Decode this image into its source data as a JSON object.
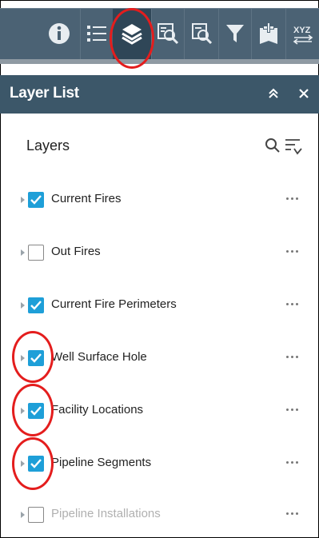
{
  "toolbar": {
    "tools": [
      {
        "icon": "info-icon"
      },
      {
        "icon": "legend-icon"
      },
      {
        "icon": "layers-icon",
        "active": true
      },
      {
        "icon": "query-icon"
      },
      {
        "icon": "query-result-icon"
      },
      {
        "icon": "filter-icon"
      },
      {
        "icon": "add-data-icon"
      },
      {
        "icon": "xyz-coordinate-icon",
        "text": "XYZ"
      }
    ]
  },
  "panel": {
    "title": "Layer List",
    "collapse_label": "≈",
    "close_label": "×"
  },
  "layers": {
    "heading": "Layers",
    "items": [
      {
        "label": "Current Fires",
        "checked": true
      },
      {
        "label": "Out Fires",
        "checked": false
      },
      {
        "label": "Current Fire Perimeters",
        "checked": true
      },
      {
        "label": "Well Surface Hole",
        "checked": true
      },
      {
        "label": "Facility Locations",
        "checked": true
      },
      {
        "label": "Pipeline Segments",
        "checked": true
      },
      {
        "label": "Pipeline Installations",
        "checked": false,
        "disabled": true
      }
    ],
    "more_glyph": "•••"
  },
  "colors": {
    "toolbar": "#4b6274",
    "header": "#3c5769",
    "checkbox": "#1e9fd8",
    "highlight": "#e41d1d"
  }
}
